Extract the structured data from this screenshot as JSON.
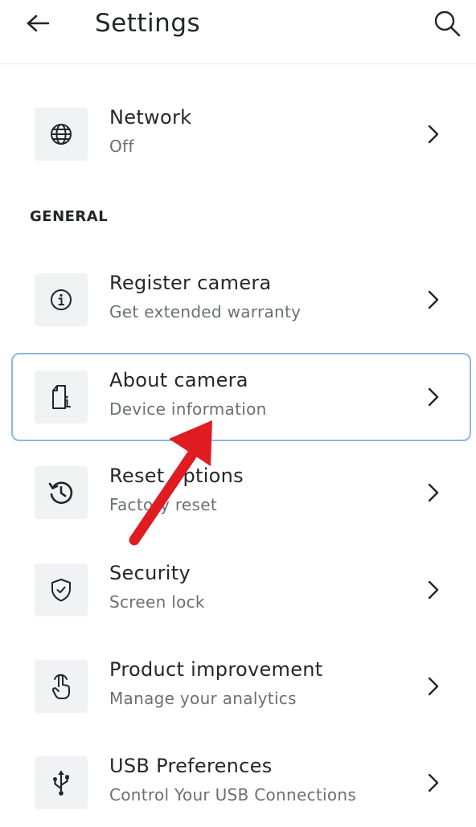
{
  "header": {
    "title": "Settings",
    "back_icon": "arrow-left-icon",
    "search_icon": "search-icon"
  },
  "sections": {
    "general_title": "GENERAL"
  },
  "items": [
    {
      "title": "Network",
      "subtitle": "Off",
      "icon": "globe-icon"
    },
    {
      "title": "Register camera",
      "subtitle": "Get extended warranty",
      "icon": "info-icon"
    },
    {
      "title": "About camera",
      "subtitle": "Device information",
      "icon": "device-info-icon",
      "selected": true
    },
    {
      "title": "Reset options",
      "subtitle": "Factory reset",
      "icon": "history-icon"
    },
    {
      "title": "Security",
      "subtitle": "Screen lock",
      "icon": "shield-icon"
    },
    {
      "title": "Product improvement",
      "subtitle": "Manage your analytics",
      "icon": "touch-icon"
    },
    {
      "title": "USB Preferences",
      "subtitle": "Control Your USB Connections",
      "icon": "usb-icon"
    }
  ],
  "colors": {
    "selection_border": "#8fb6e8",
    "annotation_arrow": "#e11b22",
    "icon_background": "#f1f2f3",
    "subtitle_text": "#6b6f75"
  }
}
